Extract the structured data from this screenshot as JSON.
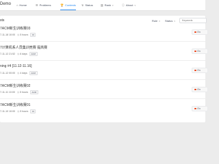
{
  "nav": {
    "brand": "Demo",
    "items": [
      {
        "label": "Home",
        "icon": "home-icon"
      },
      {
        "label": "Problems",
        "icon": "list-icon"
      },
      {
        "label": "Contests",
        "icon": "trophy-icon",
        "active": true
      },
      {
        "label": "Status",
        "icon": "status-icon"
      },
      {
        "label": "Rank",
        "icon": "rank-icon",
        "dropdown": true
      },
      {
        "label": "About",
        "icon": "info-icon",
        "dropdown": true
      }
    ],
    "active_color": "#2d8cf0"
  },
  "contests": {
    "title": "sts",
    "filters": {
      "rule": "Rule",
      "status": "Status"
    },
    "search_placeholder": "Keywords",
    "rows": [
      {
        "title": "7ACM新生训练赛03",
        "start": "7-11-18 10:00",
        "duration": "5 hours",
        "tag": "OI",
        "status": "En"
      },
      {
        "title": "7计算机系人员集训竞赛 提高赛",
        "start": "7-11-12 21:52",
        "duration": "6 days",
        "tag": "ACM",
        "status": "En"
      },
      {
        "title": "ning #4 [11.12-11.16]",
        "start": "7-11-12 00:00",
        "duration": "4 days",
        "tag": "ACM",
        "status": "En"
      },
      {
        "title": "7ACM新生训练赛02",
        "start": "7-11-11 10:00",
        "duration": "5 hours",
        "tag": "ACM",
        "status": "En"
      },
      {
        "title": "7ACM新生训练赛01",
        "start": "7-11-10 10:00",
        "duration": "5 hours",
        "tag": "OI",
        "status": "En"
      }
    ],
    "status_color": "#ed3f14"
  }
}
